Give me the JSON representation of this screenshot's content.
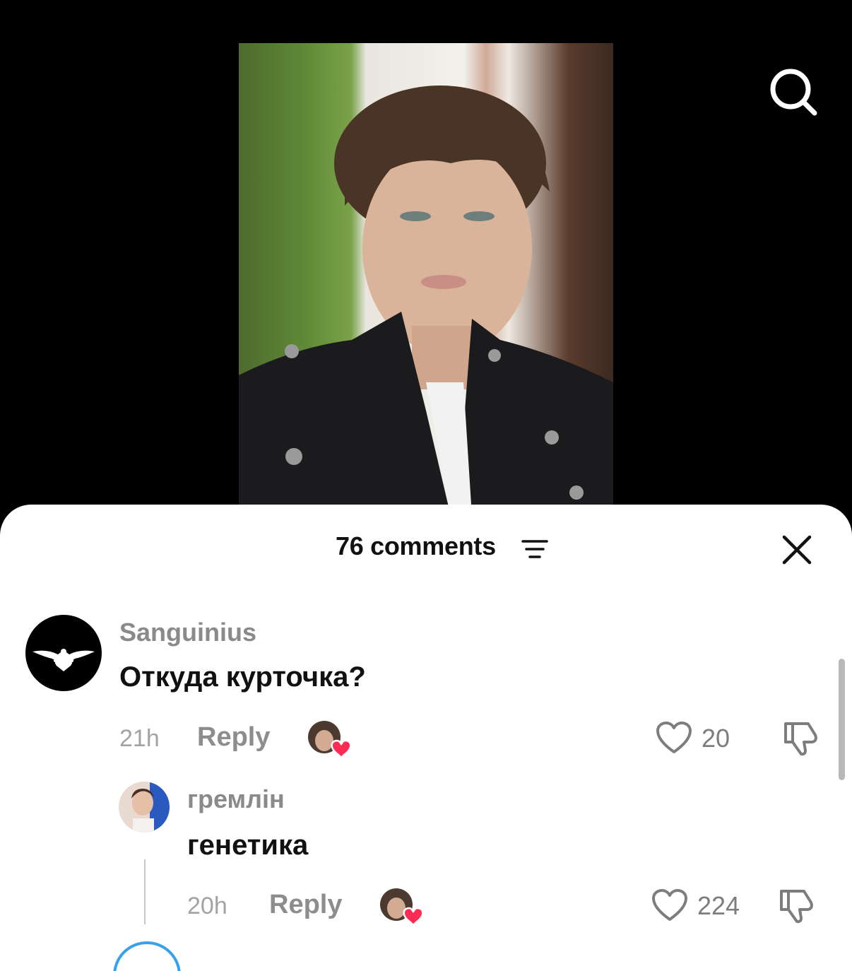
{
  "video": {
    "search_icon": "search-icon"
  },
  "comments_panel": {
    "title": "76 comments",
    "sort_icon": "sort-filter-icon",
    "close_icon": "close-icon"
  },
  "comments": [
    {
      "username": "Sanguinius",
      "text": "Откуда курточка?",
      "time": "21h",
      "reply_label": "Reply",
      "likes": "20",
      "liked_by_creator": true
    },
    {
      "username": "гремлін",
      "text": "генетика",
      "time": "20h",
      "reply_label": "Reply",
      "likes": "224",
      "liked_by_creator": true
    }
  ],
  "colors": {
    "heart": "#fe2c55",
    "scroll_ring": "#3aa0e8"
  }
}
